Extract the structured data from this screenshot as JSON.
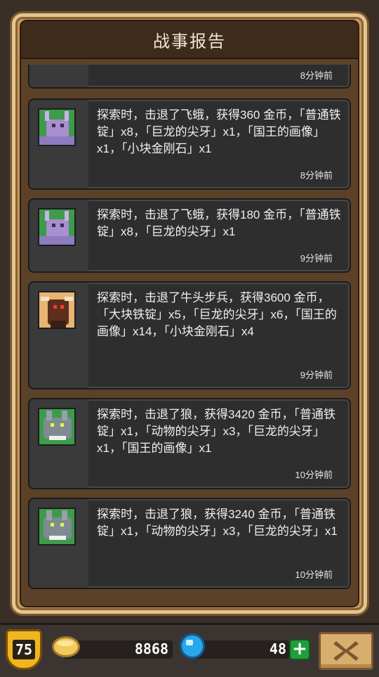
{
  "panel": {
    "title": "战事报告"
  },
  "entries": [
    {
      "message": "",
      "time": "8分钟前",
      "portrait": "none"
    },
    {
      "message": "探索时，击退了飞蛾，获得360 金币，「普通铁锭」x8，「巨龙的尖牙」x1，「国王的画像」x1，「小块金刚石」x1",
      "time": "8分钟前",
      "portrait": "moth-portrait"
    },
    {
      "message": "探索时，击退了飞蛾，获得180 金币，「普通铁锭」x8，「巨龙的尖牙」x1",
      "time": "9分钟前",
      "portrait": "moth-portrait"
    },
    {
      "message": "探索时，击退了牛头步兵，获得3600 金币，「大块铁锭」x5，「巨龙的尖牙」x6，「国王的画像」x14，「小块金刚石」x4",
      "time": "9分钟前",
      "portrait": "minotaur-portrait"
    },
    {
      "message": "探索时，击退了狼，获得3420 金币，「普通铁锭」x1，「动物的尖牙」x3，「巨龙的尖牙」x1，「国王的画像」x1",
      "time": "10分钟前",
      "portrait": "wolf-portrait"
    },
    {
      "message": "探索时，击退了狼，获得3240 金币，「普通铁锭」x1，「动物的尖牙」x3，「巨龙的尖牙」x1",
      "time": "10分钟前",
      "portrait": "wolf-portrait"
    }
  ],
  "hud": {
    "level": "75",
    "gold": "8868",
    "gems": "48",
    "add_label": "+",
    "icons": {
      "coin": "coin-icon",
      "gem": "gem-icon",
      "add": "plus-icon",
      "close": "close-x-icon"
    }
  }
}
